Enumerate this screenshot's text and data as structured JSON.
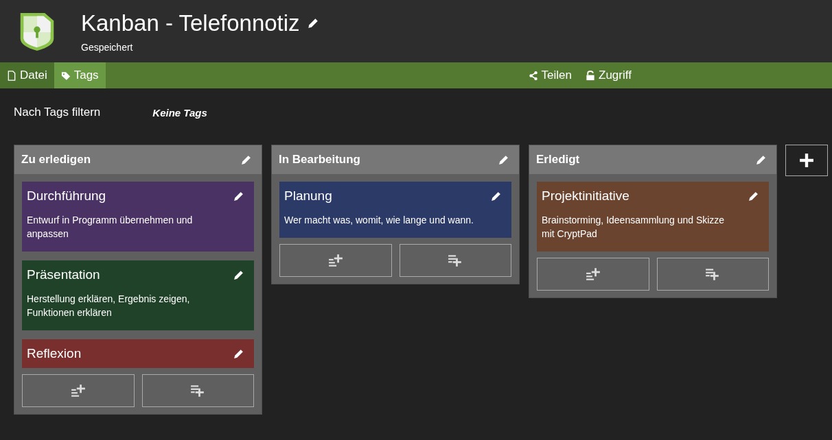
{
  "header": {
    "title": "Kanban - Telefonnotiz",
    "status": "Gespeichert"
  },
  "toolbar": {
    "tabs": [
      {
        "label": "Datei",
        "selected": false
      },
      {
        "label": "Tags",
        "selected": true
      }
    ],
    "actions": [
      "Teilen",
      "Zugriff"
    ]
  },
  "filter": {
    "label": "Nach Tags filtern",
    "value": "Keine Tags"
  },
  "columns": [
    {
      "title": "Zu erledigen",
      "cards": [
        {
          "title": "Durchführung",
          "text": "Entwurf in Programm übernehmen und anpassen",
          "color": "#4b3264"
        },
        {
          "title": "Präsentation",
          "text": "Herstellung erklären, Ergebnis zeigen, Funktionen erklären",
          "color": "#1f4228"
        },
        {
          "title": "Reflexion",
          "color": "#7a2f2f"
        }
      ]
    },
    {
      "title": "In Bearbeitung",
      "cards": [
        {
          "title": "Planung",
          "text": "Wer macht was, womit, wie lange und wann.",
          "color": "#2c3a68"
        }
      ]
    },
    {
      "title": "Erledigt",
      "cards": [
        {
          "title": "Projektinitiative",
          "text": "Brainstorming, Ideensammlung und Skizze mit CryptPad",
          "color": "#6b4430"
        }
      ]
    }
  ]
}
